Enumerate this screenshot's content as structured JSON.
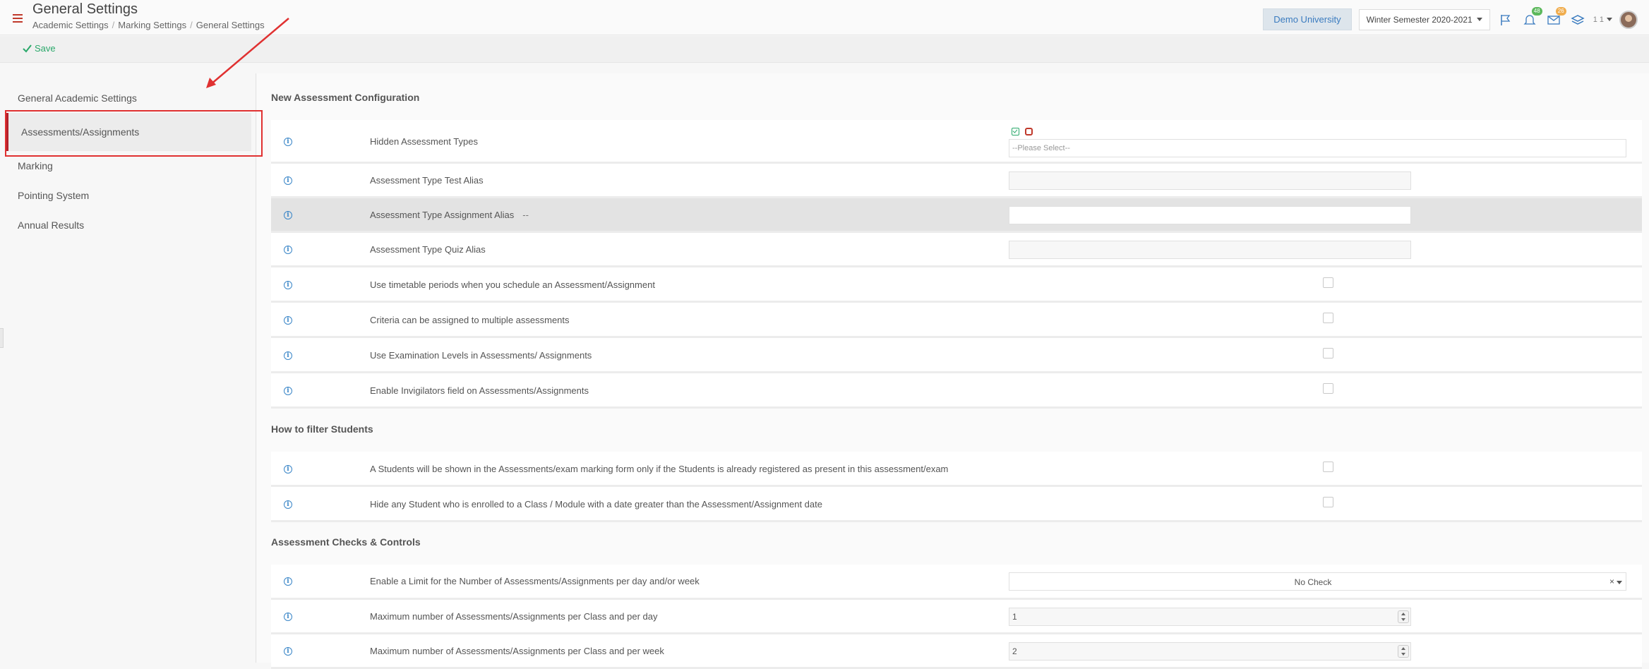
{
  "header": {
    "title": "General Settings",
    "breadcrumb": [
      "Academic Settings",
      "Marking Settings",
      "General Settings"
    ],
    "university": "Demo University",
    "semester": "Winter Semester 2020-2021",
    "notifications_count": "48",
    "messages_count": "26",
    "user_num": "1 1"
  },
  "toolbar": {
    "save_label": "Save"
  },
  "sidebar": {
    "items": [
      {
        "label": "General Academic Settings"
      },
      {
        "label": "Assessments/Assignments"
      },
      {
        "label": "Marking"
      },
      {
        "label": "Pointing System"
      },
      {
        "label": "Annual Results"
      }
    ]
  },
  "main": {
    "section1": {
      "title": "New Assessment Configuration",
      "hidden_types_label": "Hidden Assessment Types",
      "hidden_types_placeholder": "--Please Select--",
      "test_alias_label": "Assessment Type Test Alias",
      "assignment_alias_label": "Assessment Type Assignment Alias",
      "assignment_alias_suffix": "--",
      "quiz_alias_label": "Assessment Type Quiz Alias",
      "timetable_label": "Use timetable periods when you schedule an Assessment/Assignment",
      "criteria_label": "Criteria can be assigned to multiple assessments",
      "exam_levels_label": "Use Examination Levels in Assessments/ Assignments",
      "invigilators_label": "Enable Invigilators field on Assessments/Assignments"
    },
    "section2": {
      "title": "How to filter Students",
      "registered_label": "A Students will be shown in the Assessments/exam marking form only if the Students is already registered as present in this assessment/exam",
      "hide_enrolled_label": "Hide any Student who is enrolled to a Class / Module with a date greater than the Assessment/Assignment date"
    },
    "section3": {
      "title": "Assessment Checks & Controls",
      "limit_label": "Enable a Limit for the Number of Assessments/Assignments per day and/or week",
      "limit_value": "No Check",
      "limit_clear": "×",
      "per_day_label": "Maximum number of Assessments/Assignments per Class and per day",
      "per_day_value": "1",
      "per_week_label": "Maximum number of Assessments/Assignments per Class and per week",
      "per_week_value": "2"
    }
  },
  "colors": {
    "accent_red": "#c0392b",
    "save_green": "#2aa86a",
    "info_blue": "#3a86c8",
    "annotation_red": "#e03131"
  }
}
